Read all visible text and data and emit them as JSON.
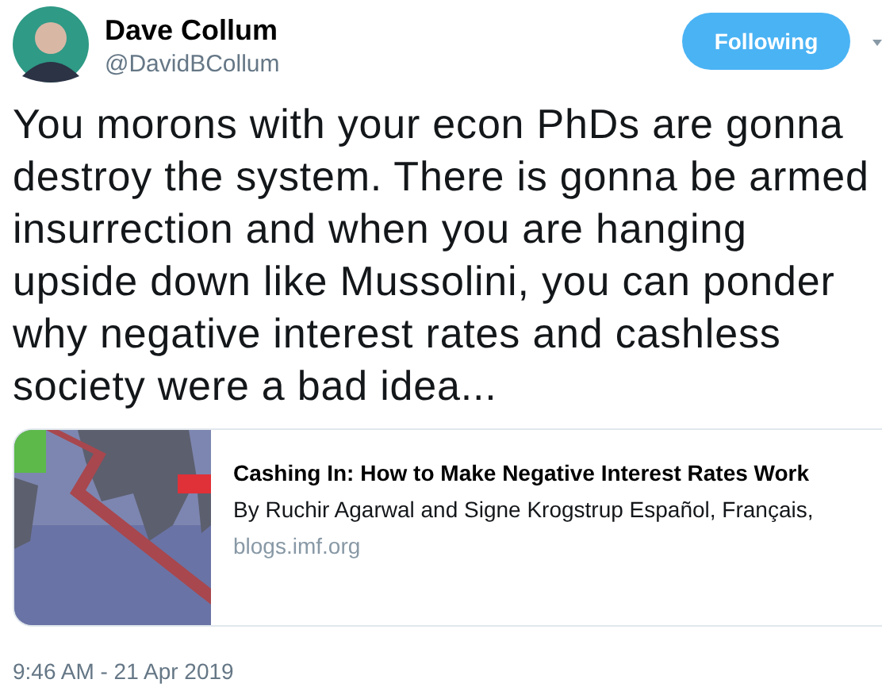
{
  "author": {
    "name": "Dave Collum",
    "handle": "@DavidBCollum"
  },
  "follow_button": {
    "label": "Following",
    "selected": true
  },
  "tweet_text": "You morons with your econ PhDs are gonna destroy the system. There is gonna be armed insurrection and when you are hanging upside down like Mussolini, you can ponder why negative interest rates and cashless society were a bad idea...",
  "link_card": {
    "title": "Cashing In: How to Make Negative Interest Rates Work",
    "description": "By Ruchir Agarwal and Signe Krogstrup Español, Français,",
    "domain": "blogs.imf.org"
  },
  "timestamp": "9:46 AM - 21 Apr 2019"
}
